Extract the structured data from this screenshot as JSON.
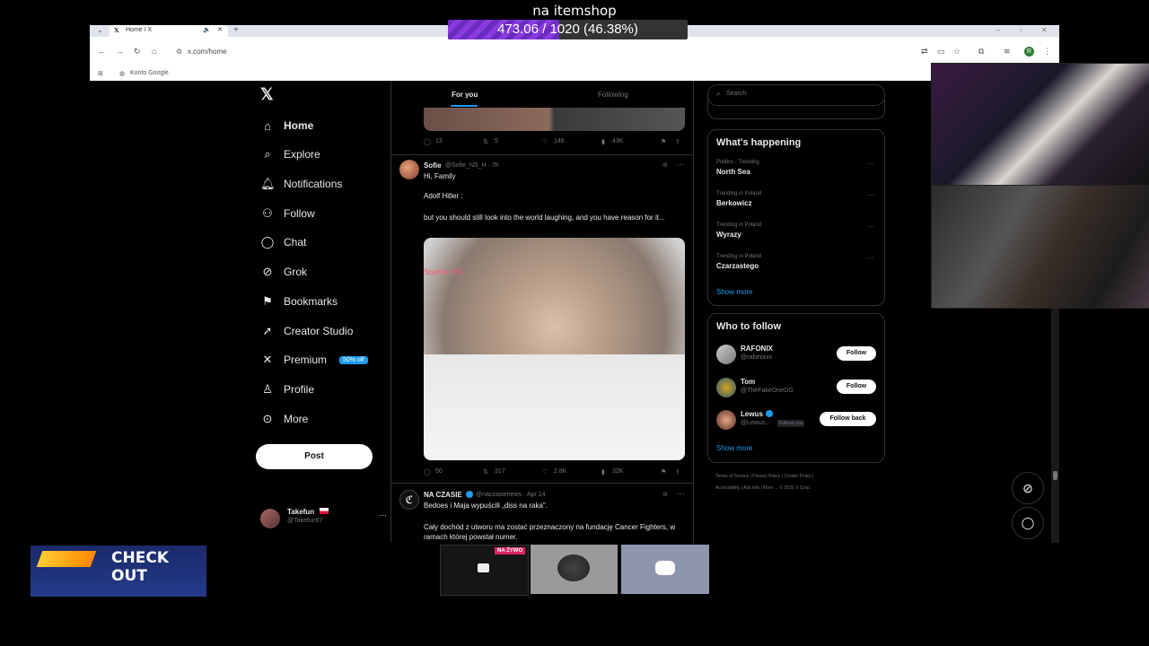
{
  "overlay": {
    "title": "na itemshop",
    "progress_text": "473.06 / 1020 (46.38%)",
    "progress_fraction": 0.4638
  },
  "browser": {
    "tab_title": "Home / X",
    "url": "x.com/home",
    "bookmark": "Konto Google"
  },
  "nav": {
    "items": [
      {
        "label": "Home",
        "icon": "home-icon"
      },
      {
        "label": "Explore",
        "icon": "search-icon"
      },
      {
        "label": "Notifications",
        "icon": "bell-icon"
      },
      {
        "label": "Follow",
        "icon": "follow-icon"
      },
      {
        "label": "Chat",
        "icon": "chat-icon"
      },
      {
        "label": "Grok",
        "icon": "grok-icon"
      },
      {
        "label": "Bookmarks",
        "icon": "bookmark-icon"
      },
      {
        "label": "Creator Studio",
        "icon": "rocket-icon"
      },
      {
        "label": "Premium",
        "icon": "x-icon"
      },
      {
        "label": "Profile",
        "icon": "profile-icon"
      },
      {
        "label": "More",
        "icon": "more-icon"
      }
    ],
    "premium_badge": "50% off",
    "post_button": "Post",
    "account_name": "Takefun",
    "account_handle": "@Takefun97"
  },
  "timeline": {
    "tabs": [
      "For you",
      "Following"
    ],
    "tweet1_stats": {
      "replies": "13",
      "reposts": "5",
      "likes": "146",
      "views": "43K"
    },
    "tweet2": {
      "author": "Sofie",
      "handle": "@Sofie_NS_H · 7h",
      "line1": "Hi, Family",
      "line2": "Adolf Hitler :",
      "line3": "but you should still look into the world laughing, and you have reason for it...",
      "image_watermark": "Sophie NS",
      "replies": "50",
      "reposts": "317",
      "likes": "2.8K",
      "views": "32K"
    },
    "tweet3": {
      "author": "NA CZASIE",
      "handle": "@naczasienews · Apr 14",
      "line1": "Bedoes i Maja wypuścili „diss na raka”.",
      "line2": "Cały dochód z utworu ma zostać przeznaczony na fundację Cancer Fighters, w ramach której powstał numer."
    }
  },
  "sidebar": {
    "search_placeholder": "Search",
    "happening_title": "What's happening",
    "trends": [
      {
        "context": "Politics · Trending",
        "name": "North Sea"
      },
      {
        "context": "Trending in Poland",
        "name": "Berkowicz"
      },
      {
        "context": "Trending in Poland",
        "name": "Wyrazy"
      },
      {
        "context": "Trending in Poland",
        "name": "Czarzastego"
      }
    ],
    "show_more": "Show more",
    "who_title": "Who to follow",
    "suggestions": [
      {
        "name": "RAFONIX",
        "handle": "@rafonixxx",
        "button": "Follow"
      },
      {
        "name": "Tom",
        "handle": "@TheFakeOneGG",
        "button": "Follow"
      },
      {
        "name": "Lewus",
        "handle": "@Lewus...",
        "button": "Follow back",
        "tag": "Follows you"
      }
    ],
    "footer1": "Terms of Service  |  Privacy Policy  |  Cookie Policy  |",
    "footer2": "Accessibility  |  Ads info  |  More ...  © 2026 X Corp."
  },
  "stream": {
    "checkout_text": "CHECK OUT",
    "live_badge": "NA ŻYWO"
  }
}
